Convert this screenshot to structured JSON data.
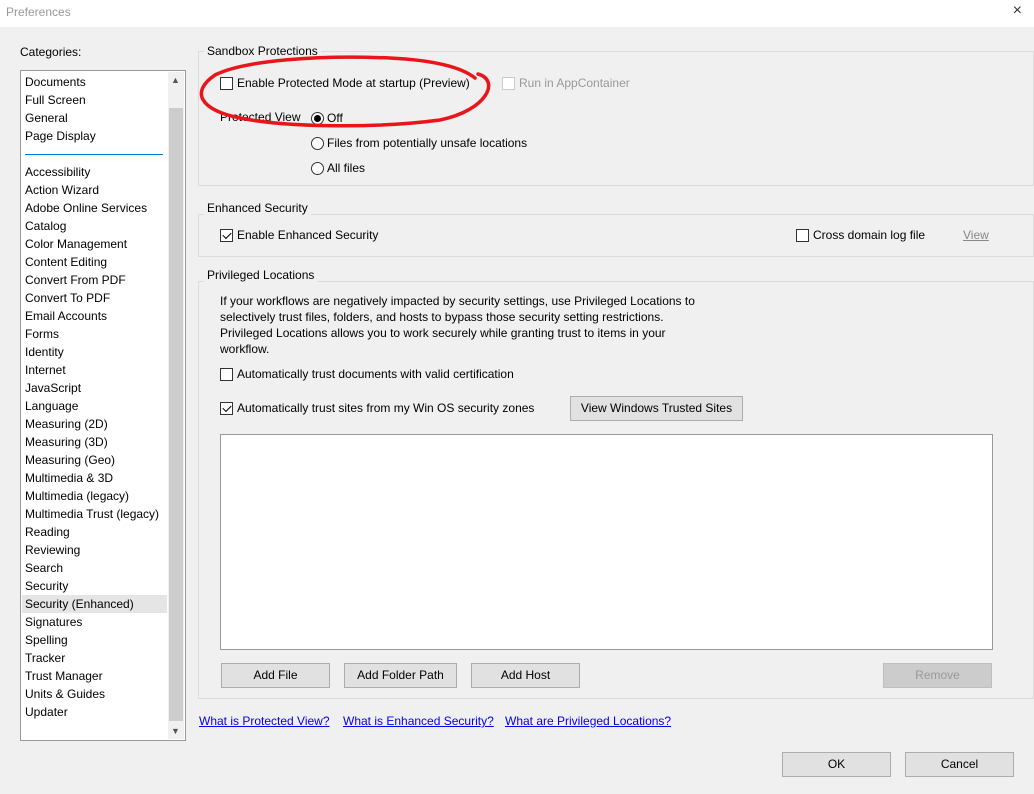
{
  "window": {
    "title": "Preferences",
    "close_icon": "×"
  },
  "categories": {
    "label": "Categories:",
    "group1": [
      "Documents",
      "Full Screen",
      "General",
      "Page Display"
    ],
    "group2": [
      "Accessibility",
      "Action Wizard",
      "Adobe Online Services",
      "Catalog",
      "Color Management",
      "Content Editing",
      "Convert From PDF",
      "Convert To PDF",
      "Email Accounts",
      "Forms",
      "Identity",
      "Internet",
      "JavaScript",
      "Language",
      "Measuring (2D)",
      "Measuring (3D)",
      "Measuring (Geo)",
      "Multimedia & 3D",
      "Multimedia (legacy)",
      "Multimedia Trust (legacy)",
      "Reading",
      "Reviewing",
      "Search",
      "Security",
      "Security (Enhanced)",
      "Signatures",
      "Spelling",
      "Tracker",
      "Trust Manager",
      "Units & Guides",
      "Updater"
    ],
    "selected": "Security (Enhanced)"
  },
  "sandbox": {
    "title": "Sandbox Protections",
    "protected_mode": "Enable Protected Mode at startup (Preview)",
    "protected_mode_checked": false,
    "appcontainer": "Run in AppContainer",
    "appcontainer_enabled": false,
    "protected_view_label": "Protected View",
    "options": [
      "Off",
      "Files from potentially unsafe locations",
      "All files"
    ],
    "selected_option": "Off"
  },
  "enhanced": {
    "title": "Enhanced Security",
    "enable": "Enable Enhanced Security",
    "enable_checked": true,
    "cross_domain": "Cross domain log file",
    "cross_domain_checked": false,
    "view": "View"
  },
  "privileged": {
    "title": "Privileged Locations",
    "description": [
      "If your workflows are negatively impacted by security settings, use Privileged Locations to",
      "selectively trust files, folders, and hosts to bypass those security setting restrictions.",
      "Privileged Locations allows you to work securely while granting trust to items in your",
      "workflow."
    ],
    "trust_cert": "Automatically trust documents with valid certification",
    "trust_cert_checked": false,
    "trust_sites": "Automatically trust sites from my Win OS security zones",
    "trust_sites_checked": true,
    "view_trusted": "View Windows Trusted Sites",
    "add_file": "Add File",
    "add_folder": "Add Folder Path",
    "add_host": "Add Host",
    "remove": "Remove"
  },
  "links": [
    "What is Protected View?",
    "What is Enhanced Security?",
    "What are Privileged Locations?"
  ],
  "footer": {
    "ok": "OK",
    "cancel": "Cancel"
  },
  "annotation_color": "#e8161b"
}
